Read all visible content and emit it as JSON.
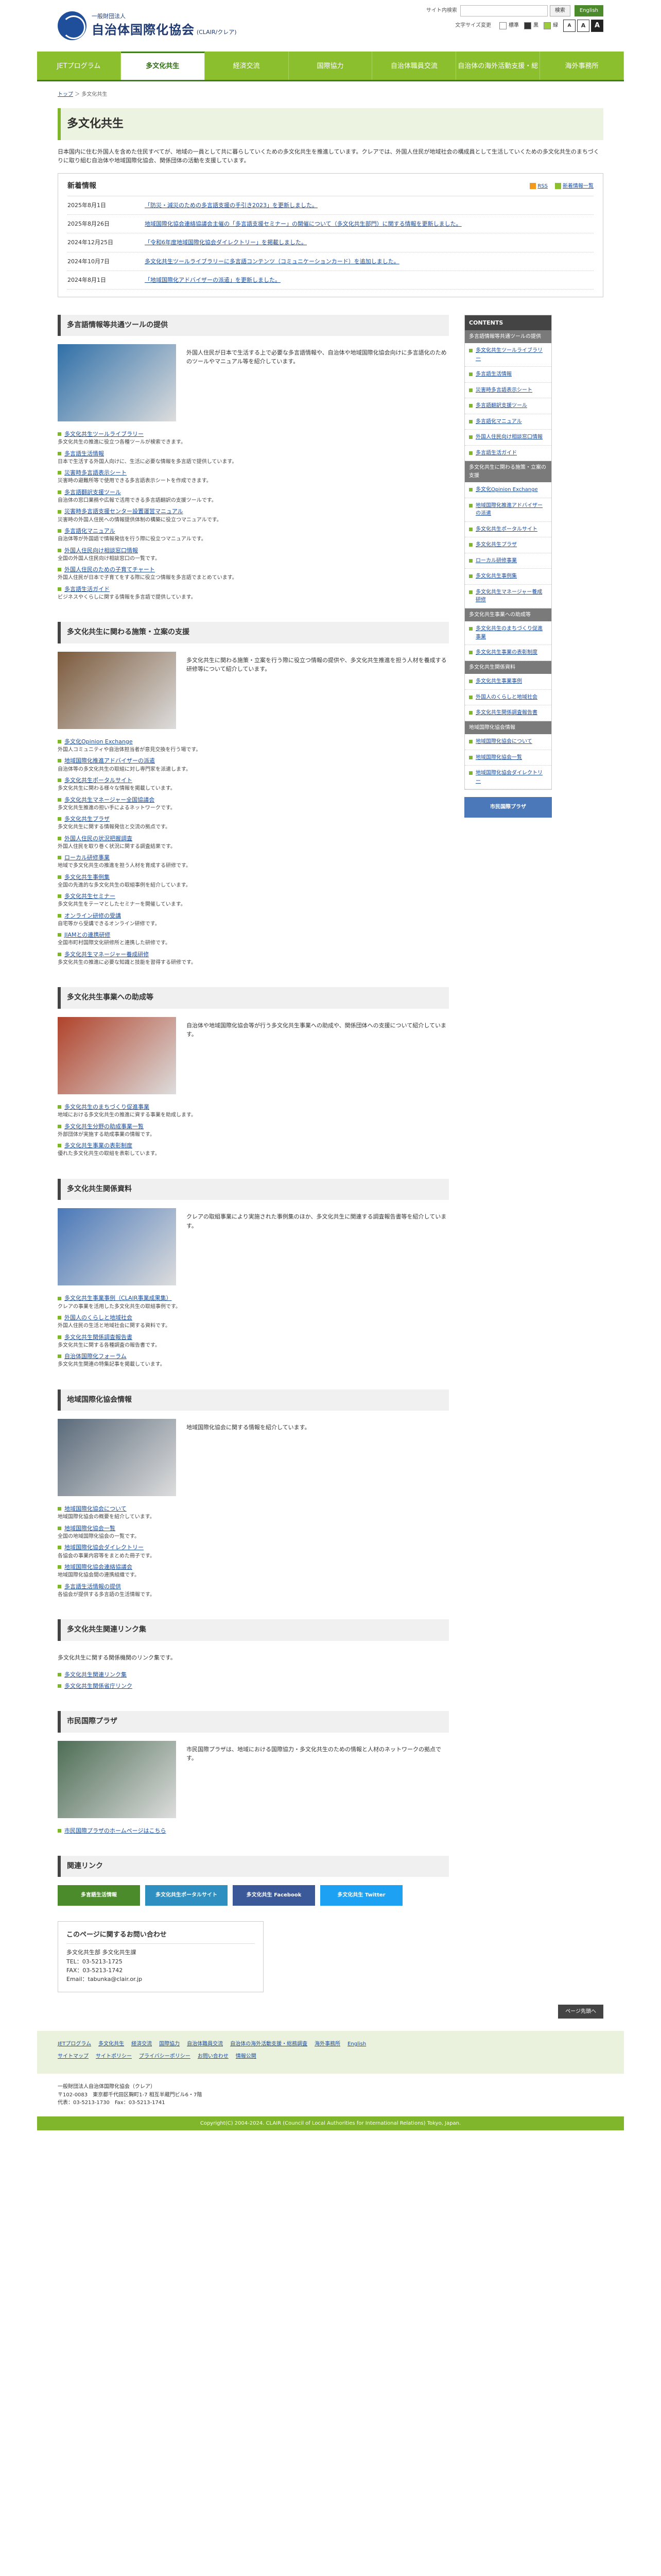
{
  "header": {
    "logo_small": "一般財団法人",
    "logo_big": "自治体国際化協会",
    "logo_sub": "(CLAIR/クレア)",
    "search_label": "サイト内検索",
    "search_button": "検索",
    "lang_button": "English",
    "font_size_label": "文字サイズ変更",
    "size_s": "A",
    "size_m": "A",
    "size_l": "A",
    "contrast_std": "標準",
    "contrast_black": "黒",
    "contrast_green": "緑"
  },
  "nav": [
    "JETプログラム",
    "多文化共生",
    "経済交流",
    "国際協力",
    "自治体職員交流",
    "自治体の海外活動支援・総務調査",
    "海外事務所"
  ],
  "breadcrumb": {
    "home": "トップ",
    "current": "多文化共生"
  },
  "page": {
    "title": "多文化共生",
    "intro": "日本国内に住む外国人を含めた住民すべてが、地域の一員として共に暮らしていくための多文化共生を推進しています。クレアでは、外国人住民が地域社会の構成員として生活していくための多文化共生のまちづくりに取り組む自治体や地域国際化協会、関係団体の活動を支援しています。"
  },
  "news": {
    "title": "新着情報",
    "rss": "RSS",
    "all": "新着情報一覧",
    "items": [
      {
        "date": "2025年8月1日",
        "text": "「防災・減災のための多言語支援の手引き2023」を更新しました。"
      },
      {
        "date": "2025年8月26日",
        "text": "地域国際化協会連絡協議会主催の「多言語支援セミナー」の開催について（多文化共生部門）に関する情報を更新しました。"
      },
      {
        "date": "2024年12月25日",
        "text": "「令和6年度地域国際化協会ダイレクトリー」を掲載しました。"
      },
      {
        "date": "2024年10月7日",
        "text": "多文化共生ツールライブラリーに多言語コンテンツ（コミュニケーションカード）を追加しました。"
      },
      {
        "date": "2024年8月1日",
        "text": "「地域国際化アドバイザーの派遣」を更新しました。"
      }
    ]
  },
  "sections": [
    {
      "title": "多言語情報等共通ツールの提供",
      "lead": "外国人住民が日本で生活する上で必要な多言語情報や、自治体や地域国際化協会向けに多言語化のためのツールやマニュアル等を紹介しています。",
      "items": [
        {
          "t": "多文化共生ツールライブラリー",
          "d": "多文化共生の推進に役立つ各種ツールが検索できます。"
        },
        {
          "t": "多言語生活情報",
          "d": "日本で生活する外国人向けに、生活に必要な情報を多言語で提供しています。"
        },
        {
          "t": "災害時多言語表示シート",
          "d": "災害時の避難所等で使用できる多言語表示シートを作成できます。"
        },
        {
          "t": "多言語翻訳支援ツール",
          "d": "自治体の窓口業務や広報で活用できる多言語翻訳の支援ツールです。"
        },
        {
          "t": "災害時多言語支援センター設置運営マニュアル",
          "d": "災害時の外国人住民への情報提供体制の構築に役立つマニュアルです。"
        },
        {
          "t": "多言語化マニュアル",
          "d": "自治体等が外国語で情報発信を行う際に役立つマニュアルです。"
        },
        {
          "t": "外国人住民向け相談窓口情報",
          "d": "全国の外国人住民向け相談窓口の一覧です。"
        },
        {
          "t": "外国人住民のための子育てチャート",
          "d": "外国人住民が日本で子育てをする際に役立つ情報を多言語でまとめています。"
        },
        {
          "t": "多言語生活ガイド",
          "d": "ビジネスやくらしに関する情報を多言語で提供しています。"
        }
      ]
    },
    {
      "title": "多文化共生に関わる施策・立案の支援",
      "lead": "多文化共生に関わる施策・立案を行う際に役立つ情報の提供や、多文化共生推進を担う人材を養成する研修等について紹介しています。",
      "items": [
        {
          "t": "多文化Opinion Exchange",
          "d": "外国人コミュニティや自治体担当者が意見交換を行う場です。"
        },
        {
          "t": "地域国際化推進アドバイザーの派遣",
          "d": "自治体等の多文化共生の取組に対し専門家を派遣します。"
        },
        {
          "t": "多文化共生ポータルサイト",
          "d": "多文化共生に関わる様々な情報を掲載しています。"
        },
        {
          "t": "多文化共生マネージャー全国協議会",
          "d": "多文化共生推進の担い手によるネットワークです。"
        },
        {
          "t": "多文化共生プラザ",
          "d": "多文化共生に関する情報発信と交流の拠点です。"
        },
        {
          "t": "外国人住民の状況把握調査",
          "d": "外国人住民を取り巻く状況に関する調査結果です。"
        },
        {
          "t": "ローカル研修事業",
          "d": "地域で多文化共生の推進を担う人材を育成する研修です。"
        },
        {
          "t": "多文化共生事例集",
          "d": "全国の先進的な多文化共生の取組事例を紹介しています。"
        },
        {
          "t": "多文化共生セミナー",
          "d": "多文化共生をテーマとしたセミナーを開催しています。"
        },
        {
          "t": "オンライン研修の受講",
          "d": "自宅等から受講できるオンライン研修です。"
        },
        {
          "t": "JIAMとの連携研修",
          "d": "全国市町村国際文化研修所と連携した研修です。"
        },
        {
          "t": "多文化共生マネージャー養成研修",
          "d": "多文化共生の推進に必要な知識と技能を習得する研修です。"
        }
      ]
    },
    {
      "title": "多文化共生事業への助成等",
      "lead": "自治体や地域国際化協会等が行う多文化共生事業への助成や、関係団体への支援について紹介しています。",
      "items": [
        {
          "t": "多文化共生のまちづくり促進事業",
          "d": "地域における多文化共生の推進に資する事業を助成します。"
        },
        {
          "t": "多文化共生分野の助成事業一覧",
          "d": "外部団体が実施する助成事業の情報です。"
        },
        {
          "t": "多文化共生事業の表彰制度",
          "d": "優れた多文化共生の取組を表彰しています。"
        }
      ]
    },
    {
      "title": "多文化共生関係資料",
      "lead": "クレアの取組事業により実施された事例集のほか、多文化共生に関連する調査報告書等を紹介しています。",
      "items": [
        {
          "t": "多文化共生事業事例（CLAIR事業成果集）",
          "d": "クレアの事業を活用した多文化共生の取組事例です。"
        },
        {
          "t": "外国人のくらしと地域社会",
          "d": "外国人住民の生活と地域社会に関する資料です。"
        },
        {
          "t": "多文化共生関係調査報告書",
          "d": "多文化共生に関する各種調査の報告書です。"
        },
        {
          "t": "自治体国際化フォーラム",
          "d": "多文化共生関連の特集記事を掲載しています。"
        }
      ]
    },
    {
      "title": "地域国際化協会情報",
      "lead": "地域国際化協会に関する情報を紹介しています。",
      "items": [
        {
          "t": "地域国際化協会について",
          "d": "地域国際化協会の概要を紹介しています。"
        },
        {
          "t": "地域国際化協会一覧",
          "d": "全国の地域国際化協会の一覧です。"
        },
        {
          "t": "地域国際化協会ダイレクトリー",
          "d": "各協会の事業内容等をまとめた冊子です。"
        },
        {
          "t": "地域国際化協会連絡協議会",
          "d": "地域国際化協会間の連携組織です。"
        },
        {
          "t": "多言語生活情報の提供",
          "d": "各協会が提供する多言語の生活情報です。"
        }
      ]
    },
    {
      "title": "多文化共生関連リンク集",
      "lead": "多文化共生に関する関係機関のリンク集です。",
      "items": [
        {
          "t": "多文化共生関連リンク集",
          "d": ""
        },
        {
          "t": "多文化共生関係省庁リンク",
          "d": ""
        }
      ]
    },
    {
      "title": "市民国際プラザ",
      "lead": "市民国際プラザは、地域における国際協力・多文化共生のための情報と人材のネットワークの拠点です。",
      "items": [
        {
          "t": "市民国際プラザのホームページはこちら",
          "d": ""
        }
      ]
    }
  ],
  "related": {
    "title": "関連リンク",
    "banners": [
      "多言語生活情報",
      "多文化共生ポータルサイト",
      "多文化共生 Facebook",
      "多文化共生 Twitter"
    ]
  },
  "contact": {
    "title": "このページに関するお問い合わせ",
    "dept": "多文化共生部 多文化共生課",
    "tel": "TEL：03-5213-1725",
    "fax": "FAX：03-5213-1742",
    "email": "Email：tabunka@clair.or.jp"
  },
  "sidebar": {
    "title": "CONTENTS",
    "groups": [
      {
        "label": "多言語情報等共通ツールの提供",
        "items": [
          "多文化共生ツールライブラリー",
          "多言語生活情報",
          "災害時多言語表示シート",
          "多言語翻訳支援ツール",
          "多言語化マニュアル",
          "外国人住民向け相談窓口情報",
          "多言語生活ガイド"
        ]
      },
      {
        "label": "多文化共生に関わる施策・立案の支援",
        "items": [
          "多文化Opinion Exchange",
          "地域国際化推進アドバイザーの派遣",
          "多文化共生ポータルサイト",
          "多文化共生プラザ",
          "ローカル研修事業",
          "多文化共生事例集",
          "多文化共生マネージャー養成研修"
        ]
      },
      {
        "label": "多文化共生事業への助成等",
        "items": [
          "多文化共生のまちづくり促進事業",
          "多文化共生事業の表彰制度"
        ]
      },
      {
        "label": "多文化共生関係資料",
        "items": [
          "多文化共生事業事例",
          "外国人のくらしと地域社会",
          "多文化共生関係調査報告書"
        ]
      },
      {
        "label": "地域国際化協会情報",
        "items": [
          "地域国際化協会について",
          "地域国際化協会一覧",
          "地域国際化協会ダイレクトリー"
        ]
      }
    ],
    "banner": "市民国際プラザ"
  },
  "pagetop": "ページ先頭へ",
  "footer": {
    "nav1": [
      "JETプログラム",
      "多文化共生",
      "経済交流",
      "国際協力",
      "自治体職員交流",
      "自治体の海外活動支援・総務調査",
      "海外事務所",
      "English"
    ],
    "nav2": [
      "サイトマップ",
      "サイトポリシー",
      "プライバシーポリシー",
      "お問い合わせ",
      "情報公開"
    ],
    "org": "一般財団法人自治体国際化協会（クレア）",
    "address": "〒102-0083　東京都千代田区麹町1-7 相互半蔵門ビル6・7階",
    "tel": "代表：03-5213-1730　Fax：03-5213-1741",
    "copyright": "Copyright(C) 2004-2024. CLAIR (Council of Local Authorities for International Relations) Tokyo, Japan."
  },
  "colors": {
    "brand_green": "#8bbf2e",
    "dark_green": "#3f7e1a",
    "logo_blue": "#1f4e9b"
  }
}
